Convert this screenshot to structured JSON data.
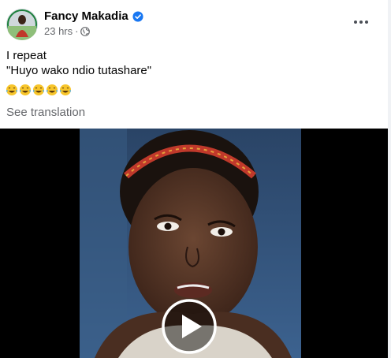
{
  "post": {
    "author": "Fancy Makadia",
    "time": "23 hrs",
    "dot": "·",
    "text_line1": "I repeat",
    "text_line2": "\"Huyo wako ndio tutashare\"",
    "see_translation": "See translation"
  },
  "icons": {
    "verified": "verified-badge-icon",
    "privacy": "globe-icon",
    "more": "more-options-icon",
    "emoji": "laughing-tears-emoji",
    "play": "play-icon"
  },
  "emoji_count": 5,
  "colors": {
    "verified": "#1877f2",
    "secondary_text": "#65676b",
    "video_bg": "#000000",
    "headband": "#c0392b"
  }
}
